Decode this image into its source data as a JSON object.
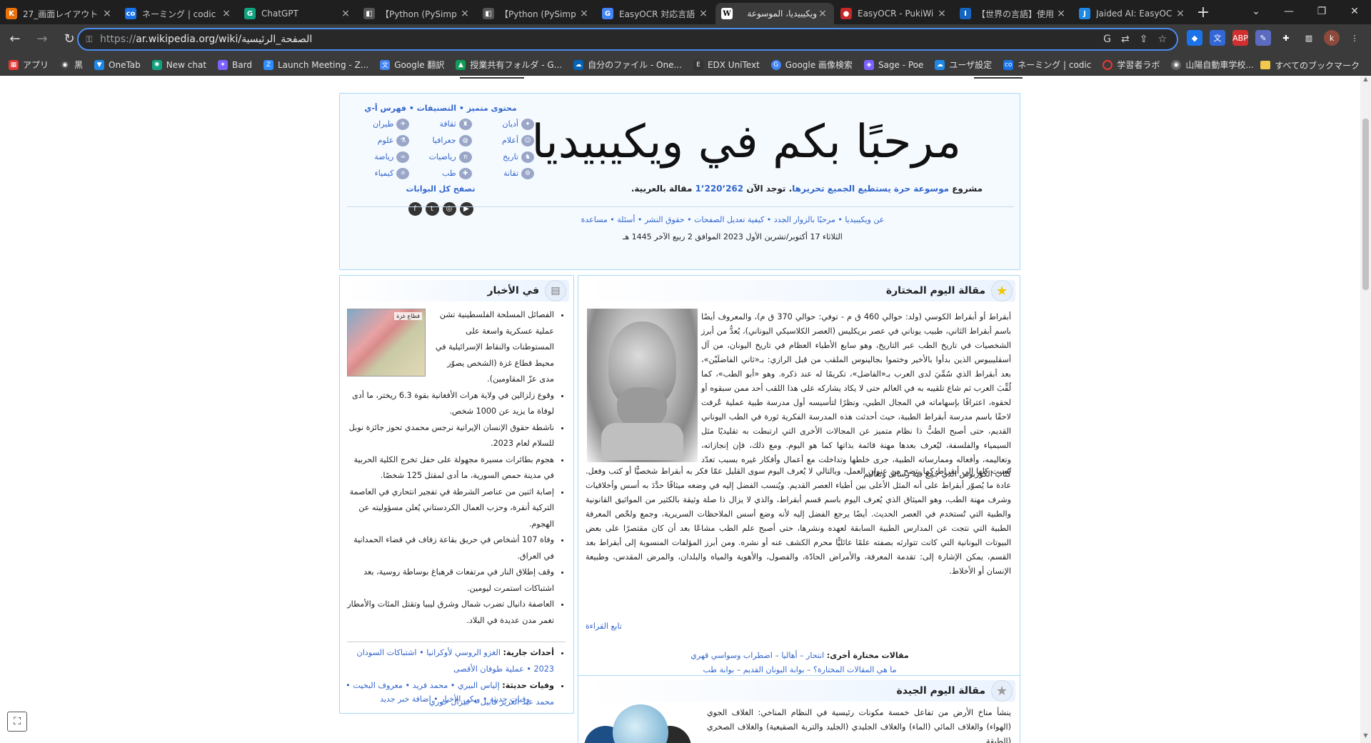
{
  "browser": {
    "tabs": [
      {
        "title": "27_画面レイアウト",
        "favicon": "K",
        "color": "#e8710a"
      },
      {
        "title": "ネーミング | codic",
        "favicon": "co",
        "color": "#1a73e8"
      },
      {
        "title": "ChatGPT",
        "favicon": "G",
        "color": "#10a37f"
      },
      {
        "title": "【Python (PySimp",
        "favicon": "◧",
        "color": "#555555"
      },
      {
        "title": "【Python (PySimp",
        "favicon": "◧",
        "color": "#555555"
      },
      {
        "title": "EasyOCR 対応言語",
        "favicon": "G",
        "color": "#4285f4"
      },
      {
        "title": "ويكيبيديا، الموسوعة",
        "favicon": "W",
        "color": "#ffffff",
        "active": true
      },
      {
        "title": "EasyOCR - PukiWi",
        "favicon": "●",
        "color": "#c62828"
      },
      {
        "title": "【世界の言語】使用",
        "favicon": "I",
        "color": "#1565c0"
      },
      {
        "title": "Jaided AI: EasyOC",
        "favicon": "J",
        "color": "#1e88e5"
      }
    ],
    "url_prefix": "https://",
    "url_host": "ar.wikipedia.org",
    "url_path": "/wiki/الصفحة_الرئيسية",
    "bookmarks": [
      {
        "label": "アプリ",
        "color": "#e53935"
      },
      {
        "label": "黒",
        "color": "#444444"
      },
      {
        "label": "OneTab",
        "color": "#1e88e5"
      },
      {
        "label": "New chat",
        "color": "#10a37f"
      },
      {
        "label": "Bard",
        "color": "#7b61ff"
      },
      {
        "label": "Launch Meeting - Z...",
        "color": "#2d8cff"
      },
      {
        "label": "Google 翻訳",
        "color": "#4285f4"
      },
      {
        "label": "授業共有フォルダ - G...",
        "color": "#0f9d58"
      },
      {
        "label": "自分のファイル - One...",
        "color": "#0364b8"
      },
      {
        "label": "EDX UniText",
        "color": "#333333"
      },
      {
        "label": "Google 画像検索",
        "color": "#4285f4"
      },
      {
        "label": "Sage - Poe",
        "color": "#7b61ff"
      },
      {
        "label": "ユーザ設定",
        "color": "#1e88e5"
      },
      {
        "label": "ネーミング | codic",
        "color": "#1a73e8"
      },
      {
        "label": "学習者ラボ",
        "color": "#e53935"
      },
      {
        "label": "山陽自動車学校...",
        "color": "#666666"
      }
    ],
    "all_bookmarks": "すべてのブックマーク"
  },
  "welcome": {
    "title": "مرحبًا بكم في ويكيبيديا",
    "subtitle_pre": "مشروع",
    "subtitle_link": "موسوعة حرة يستطيع الجميع تحريرها",
    "subtitle_mid": ". توجد الآن",
    "article_count": "1٬220٬262",
    "subtitle_post": "مقالة بالعربية.",
    "links": "عن ويكيبيديا • مرحبًا بالزوار الجدد • كيفية تعديل الصفحات • حقوق النشر • أسئلة • مساعدة",
    "date": "الثلاثاء 17 أكتوبر/تشرين الأول 2023 الموافق 2 ربيع الآخر 1445 هـ"
  },
  "portals": {
    "top_links": "محتوى متميز • التصنيفات • فهرس أ-ي",
    "items": [
      "أديان",
      "ثقافة",
      "طيران",
      "أعلام",
      "جغرافيا",
      "علوم",
      "تاريخ",
      "رياضيات",
      "رياضة",
      "تقانة",
      "طب",
      "كيمياء"
    ],
    "browse_all": "تصفح كل البوابات",
    "social": [
      "f",
      "t",
      "◎",
      "▶"
    ]
  },
  "featured": {
    "heading": "مقالة اليوم المختارة",
    "text_1": "أبقراط أو أبقراط الكوسي (ولد: حوالي 460 ق م - توفي: حوالي 370 ق م)، والمعروف أيضًا باسم أبقراط الثاني، طبيب يوناني في عصر بريكليس (العصر الكلاسيكي اليوناني)، يُعدُّ من أبرز الشخصيات في تاريخ الطب عبر التاريخ، وهو سابع الأطباء العظام في تاريخ اليونان، من آل أسقليبيوس الذين بدأوا بالأخير وختموا بجالينوس الملقب من قبل الرازي: بـ«ثاني الفاضلَيْن»، بعد أبقراط الذي سُمِّيَ لدى العرب بـ«الفاضل»، تكريمًا له عند ذكره. وهو «أبو الطب»، كما لُقِّبَ العرب ثم شاع تلقيبه به في العالم حتى لا يكاد يشاركه على هذا اللقب أحد ممن سبقوه أو لحقوه، اعترافًا بإسهاماته في المجال الطبي، ونظرًا لتأسيسه أول مدرسة طبية عملية عُرفت لاحقًا باسم مدرسة أبقراط الطبية، حيث أحدثت هذه المدرسة الفكرية ثورة في الطب اليوناني القديم، حتى أصبح الطبُّ ذا نظام متميز عن المجالات الأخرى التي ارتبطت به تقليديًا مثل السيمياء والفلسفة، ليُعرف بعدها مهنة قائمة بذاتها كما هو اليوم. ومع ذلك، فإن إنجازاته، وتعاليمه، وأفعاله وممارساته الطبية، جرى خلطها وتداخلت مع أعمال وأفكار غيره بسبب تعدّد كُتّاب الكوربوس الذي جُمِع فيه رسائل وتعاليم",
    "text_2": "نُسبت كلها إلى أبقراط كما يتضح من عنوان العمل، وبالتالي لا يُعرف اليوم سوى القليل عمّا فكر به أبقراط شخصيًّا أو كتب وفعل. عادة ما يُصوّر أبقراط على أنه المثل الأعلى بين أطباء العصر القديم. ويُنسب الفضل إليه في وضعه ميثاقًا حدَّدَ به أسس وأخلاقيات وشرف مهنة الطب، وهو الميثاق الذي يُعرف اليوم باسم قسم أبقراط، والذي لا يزال ذا صلة وثيقة بالكثير من المواثيق القانونية والطبية التي تُستخدم في العصر الحديث. أيضًا يرجع الفضل إليه لأنه وضع أسس الملاحظات السريرية، وجمع ولخّص المعرفة الطبية التي نتجت عن المدارس الطبية السابقة لعهده ونشرها، حتى أصبح علم الطب مشاعًا بعد أن كان مقتصرًا على بعض البيوتات اليونانية التي كانت تتوارثه بصفته علمًا عائليًّا محرم الكشف عنه أو نشره. ومن أبرز المؤلفات المنسوبة إلى أبقراط بعد القسم، يمكن الإشارة إلى: تقدمة المعرفة، والأمراض الحادّة، والفصول، والأهوية والمياه والبلدان، والمرض المقدس، وطبيعة الإنسان أو الأخلاط.",
    "read_more": "تابع القراءة",
    "others_label": "مقالات مختارة أخرى:",
    "others": "انتحار – أهاليا – اضطراب وسواسي قهري",
    "others_2": "ما هي المقالات المختارة؟ – بوابة اليونان القديم – بوابة طب"
  },
  "good": {
    "heading": "مقالة اليوم الجيدة",
    "text": "ينشأ مناخ الأرض من تفاعل خمسة مكونات رئيسية في النظام المناخي: الغلاف الجوي (الهواء) والغلاف المائي (الماء) والغلاف الجليدي (الجليد والتربة الصقيعية) والغلاف الصخري (الطبقة"
  },
  "news": {
    "heading": "في الأخبار",
    "map_label": "قطاع غزة",
    "items": [
      "الفصائل المسلحة الفلسطينية تشن عملية عسكرية واسعة على المستوطنات والنقاط الإسرائيلية في محيط قطاع غزة (الشخص يصوّر مدى عزّ المقاومين).",
      "وقوع زلزالين في ولاية هرات الأفغانية بقوة 6.3 ريختر، ما أدى لوفاة ما يزيد عن 1000 شخص.",
      "ناشطة حقوق الإنسان الإيرانية نرجس محمدي تحوز جائزة نوبل للسلام لعام 2023.",
      "هجوم بطائرات مسيرة مجهولة على حفل تخرج الكلية الحربية في مدينة حمص السورية، ما أدى لمقتل 125 شخصًا.",
      "إصابة اثنين من عناصر الشرطة في تفجير انتحاري في العاصمة التركية أنقرة، وحزب العمال الكردستاني يُعلن مسؤوليته عن الهجوم.",
      "وفاة 107 أشخاص في حريق بقاعة زفاف في قضاء الحمدانية في العراق.",
      "وقف إطلاق النار في مرتفعات قرهباغ بوساطة روسية، بعد اشتباكات استمرت ليومين.",
      "العاصفة دانيال تضرب شمال وشرق ليبيا وتقتل المئات والأمطار تغمر مدن عديدة في البلاد."
    ],
    "current_label": "أحداث جارية:",
    "current": "الغزو الروسي لأوكرانيا • اشتباكات السودان 2023 • عملية طوفان الأقصى",
    "deaths_label": "وفيات حديثة:",
    "deaths": "إلياس البيري • محمد فريد • معروف البخيت • محمد عبد العزيز قابيل • جيزال خوري",
    "footer": "وفيات حديثة • ويكي الأخبار • إضافة خبر جديد"
  }
}
